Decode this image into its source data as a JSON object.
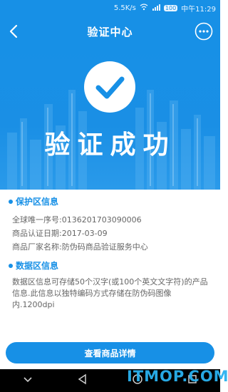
{
  "status_bar": {
    "speed": "5.5K/s",
    "battery": "100",
    "time": "中午11:29"
  },
  "topbar": {
    "title": "验证中心",
    "back_icon": "chevron-left-icon",
    "more_icon": "ellipsis-circle-icon"
  },
  "hero": {
    "success_text": "验证成功",
    "check_icon": "check-circle-icon"
  },
  "protect_section": {
    "title": "保护区信息",
    "serial": "全球唯一序号:0136201703090006",
    "date": "商品认证日期:2017-03-09",
    "vendor": "商品厂家名称:防伪码商品验证服务中心"
  },
  "data_section": {
    "title": "数据区信息",
    "description": "数据区信息可存储50个汉字(或100个英文文字符)的产品信息.此信息以独特编码方式存储在防伪码图像内.1200dpi"
  },
  "button": {
    "label": "查看商品详情"
  },
  "watermark": "ITMOP.COM",
  "colors": {
    "primary": "#1790e6",
    "text": "#666666",
    "watermark": "#2ab2f0"
  }
}
